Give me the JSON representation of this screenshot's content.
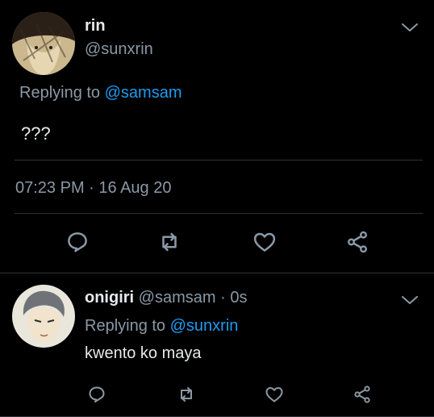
{
  "main_tweet": {
    "display_name": "rin",
    "handle": "@sunxrin",
    "replying_prefix": "Replying to",
    "replying_to": "@samsam",
    "text": "???",
    "timestamp": "07:23 PM · 16 Aug 20"
  },
  "reply": {
    "display_name": "onigiri",
    "handle_time": "@samsam · 0s",
    "replying_prefix": "Replying to",
    "replying_to": "@sunxrin",
    "text": "kwento ko maya"
  },
  "colors": {
    "background": "#000000",
    "text": "#e7e9ea",
    "muted": "#8b98a5",
    "link": "#1d9bf0",
    "divider": "#2f3336"
  },
  "icons": [
    "chevron-down-icon",
    "reply-icon",
    "retweet-icon",
    "like-icon",
    "share-icon"
  ]
}
